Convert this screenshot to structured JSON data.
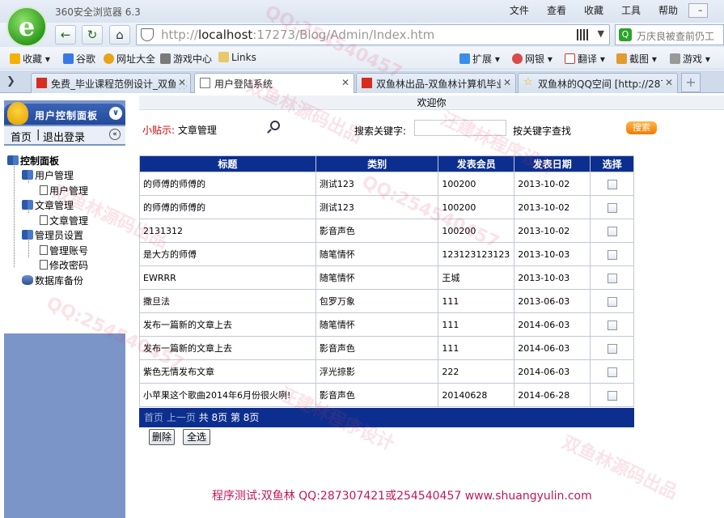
{
  "browser": {
    "title": "360安全浏览器 6.3",
    "menu": [
      "文件",
      "查看",
      "收藏",
      "工具",
      "帮助"
    ],
    "url_prefix": "http://",
    "url_host": "localhost",
    "url_rest": ":17273/Blog/Admin/Index.htm",
    "search_text": "万庆良被查前仍工",
    "bookmarks": [
      "收藏",
      "谷歌",
      "网址大全",
      "游戏中心",
      "Links"
    ],
    "toolbar_right": [
      "扩展",
      "网银",
      "翻译",
      "截图",
      "游戏"
    ],
    "tabs": [
      "免费_毕业课程范例设计_双鱼林",
      "用户登陆系统",
      "双鱼林出品-双鱼林计算机毕业",
      "双鱼林的QQ空间 [http://287"
    ],
    "tab_active": 1
  },
  "sidebar": {
    "header": "用户控制面板",
    "links": [
      "首页",
      "退出登录"
    ],
    "tree": [
      "控制面板",
      "用户管理",
      "用户管理",
      "文章管理",
      "文章管理",
      "管理员设置",
      "管理账号",
      "修改密码",
      "数据库备份"
    ]
  },
  "main": {
    "welcome": "欢迎你",
    "tip_label": "小贴示:",
    "tip_value": "文章管理",
    "keyword_label": "搜索关键字:",
    "keyword_by": "按关键字查找",
    "search_button": "搜索",
    "columns": [
      "标题",
      "类别",
      "发表会员",
      "发表日期",
      "选择"
    ],
    "rows": [
      [
        "的师傅的师傅的",
        "测试123",
        "100200",
        "2013-10-02"
      ],
      [
        "的师傅的师傅的",
        "测试123",
        "100200",
        "2013-10-02"
      ],
      [
        "2131312",
        "影音声色",
        "100200",
        "2013-10-02"
      ],
      [
        "是大方的师傅",
        "随笔情怀",
        "123123123123",
        "2013-10-03"
      ],
      [
        "EWRRR",
        "随笔情怀",
        "王城",
        "2013-10-03"
      ],
      [
        "撒旦法",
        "包罗万象",
        "111",
        "2013-06-03"
      ],
      [
        "发布一篇新的文章上去",
        "随笔情怀",
        "111",
        "2014-06-03"
      ],
      [
        "发布一篇新的文章上去",
        "影音声色",
        "111",
        "2014-06-03"
      ],
      [
        "紫色无情发布文章",
        "浮光掠影",
        "222",
        "2014-06-03"
      ],
      [
        "小苹果这个歌曲2014年6月份很火咧!",
        "影音声色",
        "20140628",
        "2014-06-28"
      ]
    ],
    "pager": {
      "first": "首页",
      "prev": "上一页",
      "total": "共 8页",
      "current": "第 8页"
    },
    "delete_button": "删除",
    "select_all_button": "全选",
    "footer": "程序测试:双鱼林 QQ:287307421或254540457 www.shuangyulin.com"
  },
  "watermarks": [
    "QQ:254540457",
    "双鱼林源码出品",
    "汪建林程序设计",
    "QQ:254540457",
    "双鱼林源码出品",
    "汪建林程序设计",
    "QQ:254540457",
    "双鱼林源码出品"
  ],
  "colors": {
    "table_header": "#0c2f8f",
    "sidebar": "#7b95c8",
    "footer_text": "#c2185b",
    "search_button": "#f07b00"
  }
}
